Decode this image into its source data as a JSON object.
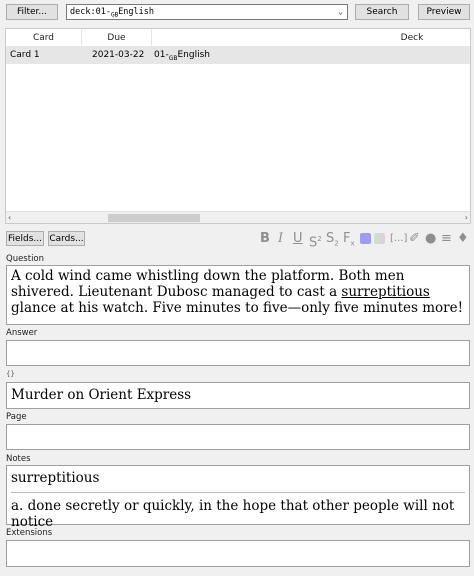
{
  "toolbar": {
    "filter_label": "Filter...",
    "query_prefix": "deck:01-",
    "query_sub": "GB",
    "query_suffix": "English",
    "search_label": "Search",
    "preview_label": "Preview"
  },
  "table": {
    "columns": [
      "Card",
      "Due",
      "Deck"
    ],
    "rows": [
      {
        "card": "Card 1",
        "due": "2021-03-22",
        "deck_prefix": "01-",
        "deck_sub": "GB",
        "deck_suffix": "English"
      }
    ]
  },
  "editor": {
    "fields_button": "Fields...",
    "cards_button": "Cards...",
    "format_icons": [
      "bold-icon",
      "italic-icon",
      "underline-icon",
      "superscript-icon",
      "subscript-icon",
      "clear-format-icon",
      "text-color-icon",
      "highlight-icon",
      "cloze-icon",
      "attach-icon",
      "record-icon",
      "more-icon",
      "tag-icon"
    ],
    "fields": {
      "question": {
        "label": "Question",
        "text_1": "A cold wind came whistling down the platform. Both men shivered. Lieutenant Dubosc managed to cast a ",
        "underlined": "surreptitious",
        "text_2": " glance at his watch. Five minutes to five—only five minutes more!"
      },
      "answer": {
        "label": "Answer",
        "value": ""
      },
      "source": {
        "label": "{}",
        "value": "Murder on Orient Express"
      },
      "page": {
        "label": "Page",
        "value": ""
      },
      "notes": {
        "label": "Notes",
        "word": "surreptitious",
        "definition": "a. done secretly or quickly, in the hope that other people will not notice"
      },
      "extensions": {
        "label": "Extensions",
        "value": ""
      }
    }
  }
}
